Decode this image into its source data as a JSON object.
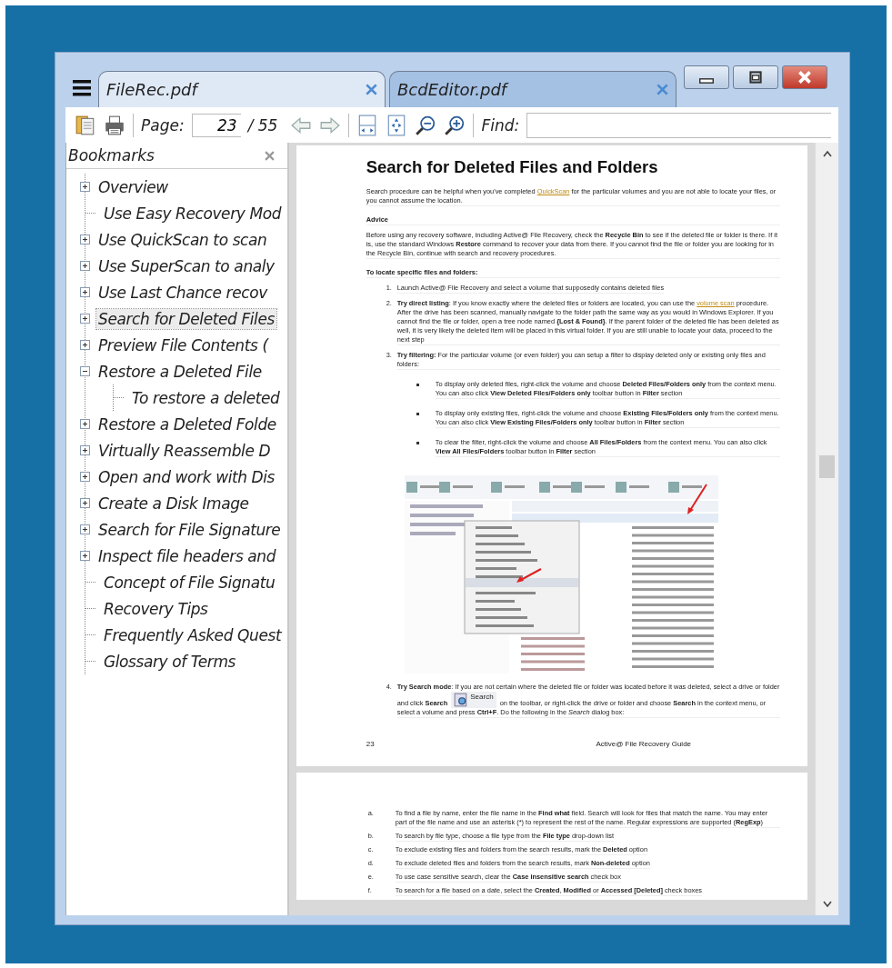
{
  "tabs": [
    {
      "label": "FileRec.pdf",
      "selected": true
    },
    {
      "label": "BcdEditor.pdf",
      "selected": false
    }
  ],
  "toolbar": {
    "page_label": "Page:",
    "page_value": "23",
    "page_total": "/ 55",
    "find_label": "Find:"
  },
  "bookmarks": {
    "title": "Bookmarks",
    "items": [
      {
        "label": "Overview",
        "expanded": false,
        "selected": false
      },
      {
        "label": "Use Easy Recovery Mod",
        "selected": false
      },
      {
        "label": "Use QuickScan to scan",
        "expanded": false,
        "selected": false
      },
      {
        "label": "Use SuperScan to analy",
        "expanded": false,
        "selected": false
      },
      {
        "label": "Use Last Chance recov",
        "expanded": false,
        "selected": false
      },
      {
        "label": "Search for Deleted Files",
        "expanded": false,
        "selected": true
      },
      {
        "label": "Preview File Contents (",
        "expanded": false,
        "selected": false
      },
      {
        "label": "Restore a Deleted File",
        "expanded": true,
        "selected": false,
        "children": [
          {
            "label": "To restore a deleted",
            "selected": false
          }
        ]
      },
      {
        "label": "Restore a Deleted Folde",
        "expanded": false,
        "selected": false
      },
      {
        "label": "Virtually Reassemble D",
        "expanded": false,
        "selected": false
      },
      {
        "label": "Open and work with Dis",
        "expanded": false,
        "selected": false
      },
      {
        "label": "Create a Disk Image",
        "expanded": false,
        "selected": false
      },
      {
        "label": "Search for File Signature",
        "expanded": false,
        "selected": false
      },
      {
        "label": "Inspect file headers and",
        "expanded": false,
        "selected": false
      },
      {
        "label": "Concept of File Signatu",
        "selected": false
      },
      {
        "label": "Recovery Tips",
        "selected": false
      },
      {
        "label": "Frequently Asked Quest",
        "selected": false
      },
      {
        "label": "Glossary of Terms",
        "selected": false
      }
    ]
  },
  "document": {
    "pages": [
      {
        "blocks": [
          {
            "kind": "heading",
            "segments": [
              {
                "kind": "text",
                "text": "Search for Deleted Files and Folders"
              }
            ]
          },
          {
            "kind": "para",
            "segments": [
              {
                "kind": "text",
                "text": "Search procedure can be helpful when you've completed "
              },
              {
                "kind": "link",
                "text": "QuickScan"
              },
              {
                "kind": "text",
                "text": " for the particular volumes and you are not able to locate your files, or you cannot assume the location."
              }
            ]
          },
          {
            "kind": "subhead",
            "segments": [
              {
                "kind": "text",
                "text": "Advice"
              }
            ]
          },
          {
            "kind": "para",
            "segments": [
              {
                "kind": "text",
                "text": "Before using any recovery software, including Active@ File Recovery, check the **Recycle Bin** to see if the deleted file or folder is there. If it is, use the standard Windows **Restore** command to recover your data from there. If you cannot find the file or folder you are looking for in the Recycle Bin, continue with search and recovery procedures."
              }
            ]
          },
          {
            "kind": "subhead",
            "segments": [
              {
                "kind": "text",
                "text": "To locate specific files and folders:"
              }
            ]
          },
          {
            "kind": "numbered",
            "marker": "1.",
            "segments": [
              {
                "kind": "text",
                "text": "Launch Active@ File Recovery and select a volume that supposedly contains deleted files"
              }
            ]
          },
          {
            "kind": "numbered",
            "marker": "2.",
            "segments": [
              {
                "kind": "text",
                "text": "**Try direct listing**: If you know exactly where the deleted files or folders are located, you can use the "
              },
              {
                "kind": "link",
                "text": "volume scan"
              },
              {
                "kind": "text",
                "text": " procedure. After the drive has been scanned, manually navigate to the folder path the same way as you would in Windows Explorer. If you cannot find the file or folder, open a tree node named **{Lost & Found}**. If the parent folder of the deleted file has been deleted as well, it is very likely the deleted item will be placed in this virtual folder. If you are still unable to locate your data, proceed to the next step"
              }
            ]
          },
          {
            "kind": "numbered",
            "marker": "3.",
            "segments": [
              {
                "kind": "text",
                "text": "**Try filtering:** For the particular volume (or even folder) you can setup a filter to display deleted only or existing only files and folders:"
              }
            ]
          },
          {
            "kind": "bullet",
            "segments": [
              {
                "kind": "text",
                "text": "To display only deleted files, right-click the volume and choose **Deleted Files/Folders only** from the context menu. You can also click **View Deleted Files/Folders only** toolbar button in **Filter** section"
              }
            ]
          },
          {
            "kind": "bullet",
            "segments": [
              {
                "kind": "text",
                "text": "To display only existing files, right-click the volume and choose **Existing Files/Folders only** from the context menu. You can also click **View Existing Files/Folders only** toolbar button in **Filter** section"
              }
            ]
          },
          {
            "kind": "bullet",
            "segments": [
              {
                "kind": "text",
                "text": "To clear the filter, right-click the volume and choose **All Files/Folders** from the context menu. You can also click **View All Files/Folders** toolbar button in **Filter** section"
              }
            ]
          },
          {
            "kind": "figure"
          },
          {
            "kind": "numbered",
            "marker": "4.",
            "segments": [
              {
                "kind": "text",
                "text": "**Try Search mode**: If you are not certain where the deleted file or folder was located before it was deleted, select a drive or folder and click **Search** "
              },
              {
                "kind": "button",
                "text": "Search"
              },
              {
                "kind": "text",
                "text": " on the toolbar, or right-click the drive or folder and choose **Search** in the context menu, or select a volume and press **Ctrl+F**. Do the following in the *Search* dialog box:"
              }
            ]
          }
        ],
        "footer": {
          "number": "23",
          "title": "Active@ File Recovery Guide"
        }
      },
      {
        "blocks": [
          {
            "kind": "lettered",
            "marker": "a.",
            "segments": [
              {
                "kind": "text",
                "text": "To find a file by name, enter the file name in the **Find what** field. Search will look for files that match the name. You may enter part of the file name and use an asterisk "
              },
              {
                "kind": "literal",
                "text": "(*)"
              },
              {
                "kind": "text",
                "text": " to represent the rest of the name. Regular expressions are supported (**RegExp**)"
              }
            ]
          },
          {
            "kind": "lettered",
            "marker": "b.",
            "segments": [
              {
                "kind": "text",
                "text": "To search by file type, choose a file type from the **File type** drop-down list"
              }
            ]
          },
          {
            "kind": "lettered",
            "marker": "c.",
            "segments": [
              {
                "kind": "text",
                "text": "To exclude existing files and folders from the search results, mark the **Deleted** option"
              }
            ]
          },
          {
            "kind": "lettered",
            "marker": "d.",
            "segments": [
              {
                "kind": "text",
                "text": "To exclude deleted files and folders from the search results, mark **Non-deleted** option"
              }
            ]
          },
          {
            "kind": "lettered",
            "marker": "e.",
            "segments": [
              {
                "kind": "text",
                "text": "To use case sensitive search, clear the **Case insensitive search** check box"
              }
            ]
          },
          {
            "kind": "lettered",
            "marker": "f.",
            "segments": [
              {
                "kind": "text",
                "text": "To search for a file based on a date, select the **Created**, **Modified** or **Accessed [Deleted]** check boxes"
              }
            ]
          }
        ]
      }
    ]
  }
}
